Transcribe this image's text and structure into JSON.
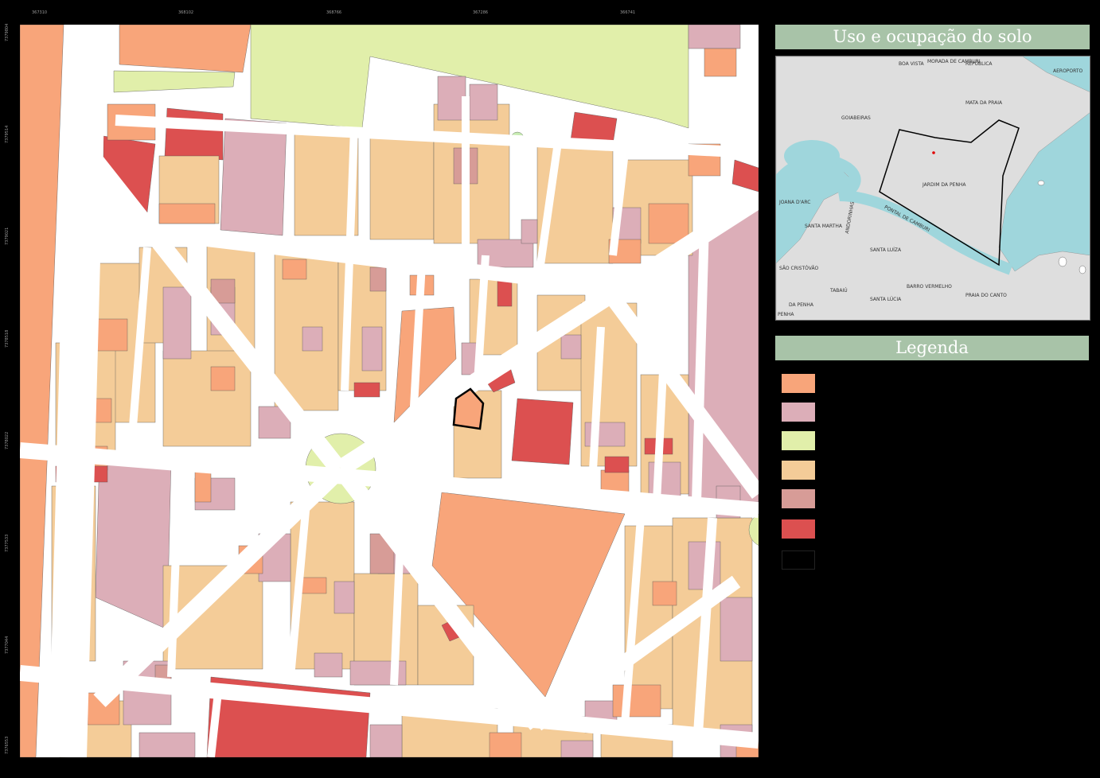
{
  "title": "Uso e ocupação do solo",
  "legend": {
    "title": "Legenda",
    "swatches": [
      {
        "color": "#f8a57a"
      },
      {
        "color": "#dcaeb8"
      },
      {
        "color": "#e1efaa"
      },
      {
        "color": "#f4cc98"
      },
      {
        "color": "#d79c97"
      },
      {
        "color": "#dc5050"
      },
      {
        "color": "#000000"
      }
    ]
  },
  "frame_ticks": {
    "top": [
      "367310",
      "368102",
      "368766",
      "367286",
      "366741"
    ],
    "left": [
      "7379804",
      "7379514",
      "7379021",
      "7378518",
      "7378022",
      "7377533",
      "7377044",
      "7376553"
    ]
  },
  "locator": {
    "labels": [
      "BOA VISTA",
      "MORADA DE CAMBURI",
      "REPÚBLICA",
      "AEROPORTO",
      "MATA DA PRAIA",
      "GOIABEIRAS",
      "JARDIM DA PENHA",
      "JOANA D'ARC",
      "SANTA MARTHA",
      "ANDORINHAS",
      "PONTAL DE CAMBURI",
      "SANTA LUÍZA",
      "SÃO CRISTÓVÃO",
      "BARRO VERMELHO",
      "TABAIÚ",
      "SANTA LÚCIA",
      "PRAIA DO CANTO",
      "DA PENHA",
      "PENHA"
    ]
  },
  "colors": {
    "commercial": "#f8a57a",
    "mixed": "#dcaeb8",
    "green": "#e1efaa",
    "residential": "#f4cc98",
    "institutional": "#d79c97",
    "vacant": "#dc5050",
    "road": "#ffffff",
    "panel": "#a8c3a8"
  }
}
